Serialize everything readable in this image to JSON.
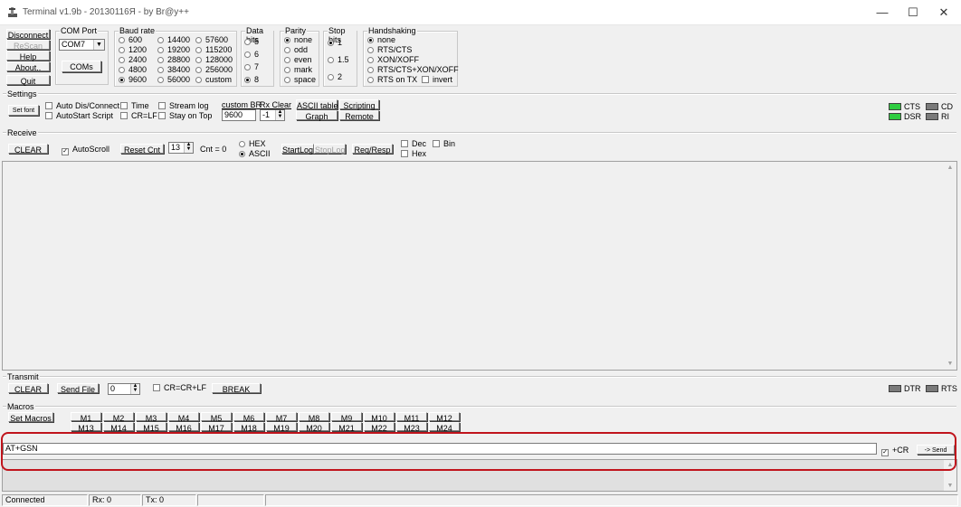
{
  "window": {
    "title": "Terminal v1.9b - 20130116Я - by Br@y++",
    "controls": {
      "minimize": "—",
      "maximize": "☐",
      "close": "✕"
    }
  },
  "top": {
    "disconnect": "Disconnect",
    "rescan": "ReScan",
    "help": "Help",
    "about": "About..",
    "quit": "Quit"
  },
  "com_port": {
    "label": "COM Port",
    "value": "COM7",
    "coms": "COMs"
  },
  "baud": {
    "label": "Baud rate",
    "options": [
      "600",
      "1200",
      "2400",
      "4800",
      "9600",
      "14400",
      "19200",
      "28800",
      "38400",
      "56000",
      "57600",
      "115200",
      "128000",
      "256000",
      "custom"
    ],
    "selected": "9600"
  },
  "data_bits": {
    "label": "Data bits",
    "options": [
      "5",
      "6",
      "7",
      "8"
    ],
    "selected": "8"
  },
  "parity": {
    "label": "Parity",
    "options": [
      "none",
      "odd",
      "even",
      "mark",
      "space"
    ],
    "selected": "none"
  },
  "stop_bits": {
    "label": "Stop bits",
    "options": [
      "1",
      "1.5",
      "2"
    ],
    "selected": "1"
  },
  "handshaking": {
    "label": "Handshaking",
    "options": [
      "none",
      "RTS/CTS",
      "XON/XOFF",
      "RTS/CTS+XON/XOFF",
      "RTS on TX"
    ],
    "selected": "none",
    "invert": "invert"
  },
  "settings": {
    "label": "Settings",
    "set_font": "Set font",
    "auto_dis_connect": "Auto Dis/Connect",
    "autostart_script": "AutoStart Script",
    "time": "Time",
    "cr_lf": "CR=LF",
    "stream_log": "Stream log",
    "stay_on_top": "Stay on Top",
    "custom_br_label": "custom BR",
    "custom_br_value": "9600",
    "rx_clear_label": "Rx Clear",
    "rx_clear_value": "-1",
    "ascii_table": "ASCII table",
    "graph": "Graph",
    "scripting": "Scripting",
    "remote": "Remote"
  },
  "leds": {
    "cts": "CTS",
    "cd": "CD",
    "dsr": "DSR",
    "ri": "RI",
    "dtr": "DTR",
    "rts": "RTS"
  },
  "receive": {
    "label": "Receive",
    "clear": "CLEAR",
    "autoscroll": "AutoScroll",
    "reset_cnt": "Reset Cnt",
    "cnt_spin": "13",
    "cnt": "Cnt = 0",
    "hex": "HEX",
    "ascii": "ASCII",
    "startlog": "StartLog",
    "stoplog": "StopLog",
    "req_resp": "Req/Resp",
    "dec": "Dec",
    "hex_cb": "Hex",
    "bin": "Bin"
  },
  "transmit": {
    "label": "Transmit",
    "clear": "CLEAR",
    "send_file": "Send File",
    "spin": "0",
    "cr_crlf": "CR=CR+LF",
    "break": "BREAK"
  },
  "macros": {
    "label": "Macros",
    "set_macros": "Set Macros",
    "row1": [
      "M1",
      "M2",
      "M3",
      "M4",
      "M5",
      "M6",
      "M7",
      "M8",
      "M9",
      "M10",
      "M11",
      "M12"
    ],
    "row2": [
      "M13",
      "M14",
      "M15",
      "M16",
      "M17",
      "M18",
      "M19",
      "M20",
      "M21",
      "M22",
      "M23",
      "M24"
    ]
  },
  "send": {
    "input_value": "AT+GSN",
    "plus_cr": "+CR",
    "send_button": "-> Send"
  },
  "status": {
    "connected": "Connected",
    "rx": "Rx: 0",
    "tx": "Tx: 0"
  }
}
